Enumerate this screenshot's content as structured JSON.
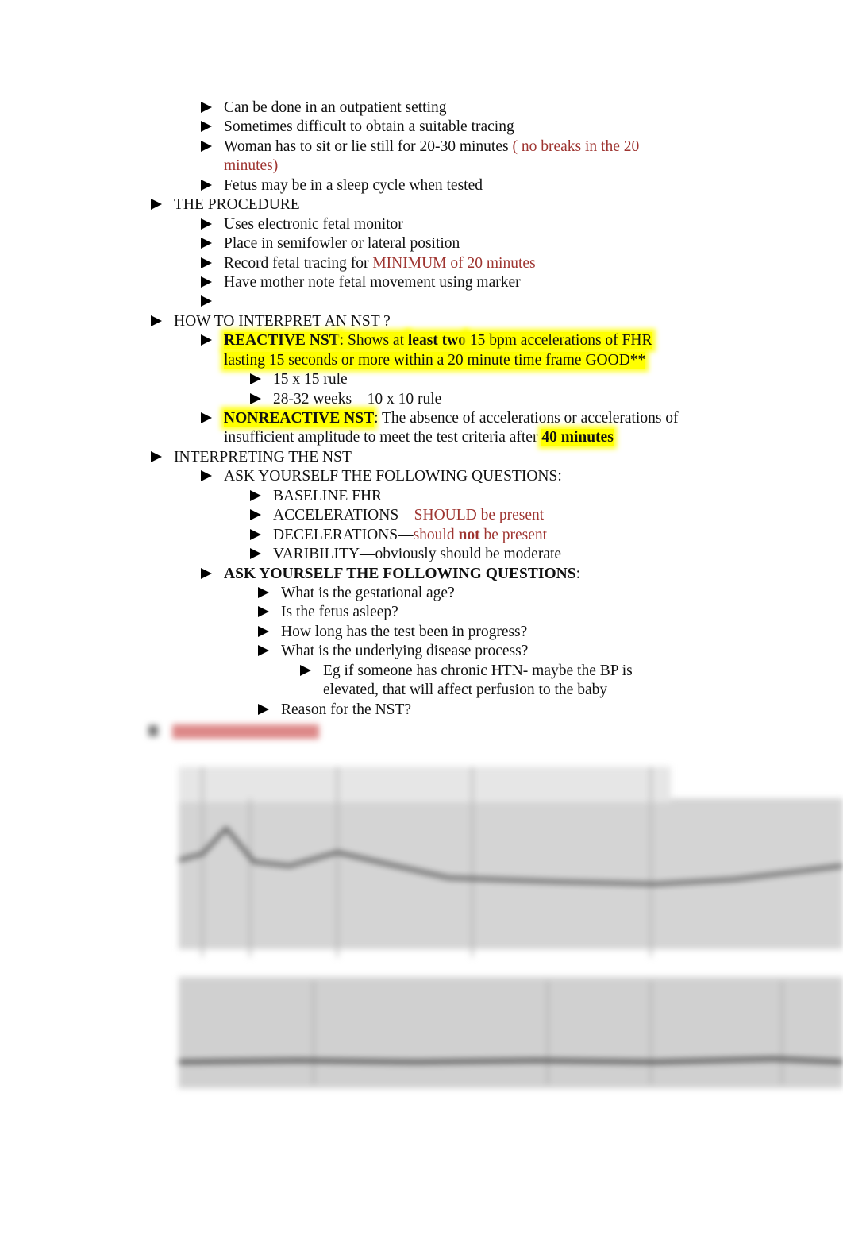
{
  "colors": {
    "accent_red": "#9e3430",
    "highlight": "#ffff00"
  },
  "bullet_icon": "black-right-triangle",
  "lines": [
    {
      "level": 2,
      "bullet": true,
      "segments": [
        {
          "t": "Can be done in an outpatient setting"
        }
      ]
    },
    {
      "level": 2,
      "bullet": true,
      "segments": [
        {
          "t": "Sometimes difficult to obtain a suitable tracing"
        }
      ]
    },
    {
      "level": 2,
      "bullet": true,
      "segments": [
        {
          "t": "Woman has to sit or lie still for 20-30 minutes "
        },
        {
          "t": "( no breaks in the 20",
          "s": "red"
        }
      ]
    },
    {
      "level": 2,
      "bullet": false,
      "segments": [
        {
          "t": "minutes)",
          "s": "red"
        }
      ]
    },
    {
      "level": 2,
      "bullet": true,
      "segments": [
        {
          "t": "Fetus may be in a sleep cycle when tested"
        }
      ]
    },
    {
      "level": 1,
      "bullet": true,
      "segments": [
        {
          "t": "THE PROCEDURE"
        }
      ]
    },
    {
      "level": 2,
      "bullet": true,
      "segments": [
        {
          "t": "Uses electronic fetal monitor"
        }
      ]
    },
    {
      "level": 2,
      "bullet": true,
      "segments": [
        {
          "t": "Place in semifowler or lateral position"
        }
      ]
    },
    {
      "level": 2,
      "bullet": true,
      "segments": [
        {
          "t": "Record fetal tracing for "
        },
        {
          "t": "MINIMUM of 20 minutes",
          "s": "red"
        }
      ]
    },
    {
      "level": 2,
      "bullet": true,
      "segments": [
        {
          "t": "Have mother note fetal movement using marker"
        }
      ]
    },
    {
      "level": 2,
      "bullet": true,
      "segments": []
    },
    {
      "level": 1,
      "bullet": true,
      "segments": [
        {
          "t": "HOW TO INTERPRET AN NST ?"
        }
      ]
    },
    {
      "level": 2,
      "bullet": true,
      "segments": [
        {
          "t": "REACTIVE NST",
          "s": "b hl"
        },
        {
          "t": ":  Shows at ",
          "s": "hl"
        },
        {
          "t": "least two",
          "s": "b hl"
        },
        {
          "t": " 15 bpm accelerations of FHR",
          "s": "hl"
        }
      ]
    },
    {
      "level": 2,
      "bullet": false,
      "segments": [
        {
          "t": "lasting 15 seconds or more within a 20 minute time frame GOOD**",
          "s": "hl"
        }
      ]
    },
    {
      "level": 3,
      "bullet": true,
      "segments": [
        {
          "t": "15 x 15 rule"
        }
      ]
    },
    {
      "level": 3,
      "bullet": true,
      "segments": [
        {
          "t": "28-32 weeks – 10 x 10 rule"
        }
      ]
    },
    {
      "level": 2,
      "bullet": true,
      "segments": [
        {
          "t": "NONREACTIVE NST",
          "s": "b hl"
        },
        {
          "t": ":  The absence of accelerations or accelerations of"
        }
      ]
    },
    {
      "level": 2,
      "bullet": false,
      "segments": [
        {
          "t": "insufficient amplitude to meet the test criteria after "
        },
        {
          "t": "40 minutes",
          "s": "b hl"
        }
      ]
    },
    {
      "level": 1,
      "bullet": true,
      "segments": [
        {
          "t": "INTERPRETING THE NST"
        }
      ]
    },
    {
      "level": 2,
      "bullet": true,
      "segments": [
        {
          "t": "ASK YOURSELF THE FOLLOWING QUESTIONS:"
        }
      ]
    },
    {
      "level": 3,
      "bullet": true,
      "segments": [
        {
          "t": "BASELINE FHR"
        }
      ]
    },
    {
      "level": 3,
      "bullet": true,
      "segments": [
        {
          "t": "ACCELERATIONS—"
        },
        {
          "t": "SHOULD be present",
          "s": "red"
        }
      ]
    },
    {
      "level": 3,
      "bullet": true,
      "segments": [
        {
          "t": "DECELERATIONS—"
        },
        {
          "t": "should ",
          "s": "red"
        },
        {
          "t": "not",
          "s": "red b"
        },
        {
          "t": " be present",
          "s": "red"
        }
      ]
    },
    {
      "level": 3,
      "bullet": true,
      "segments": [
        {
          "t": "VARIBILITY—obviously should be moderate"
        }
      ]
    },
    {
      "level": 2,
      "bullet": true,
      "segments": [
        {
          "t": "ASK YOURSELF THE FOLLOWING QUESTIONS",
          "s": "b"
        },
        {
          "t": ":"
        }
      ]
    },
    {
      "level": 3.5,
      "bullet": true,
      "segments": [
        {
          "t": "What is the gestational age?"
        }
      ]
    },
    {
      "level": 3.5,
      "bullet": true,
      "segments": [
        {
          "t": "Is the fetus asleep?"
        }
      ]
    },
    {
      "level": 3.5,
      "bullet": true,
      "segments": [
        {
          "t": "How long has the test been in progress?"
        }
      ]
    },
    {
      "level": 3.5,
      "bullet": true,
      "segments": [
        {
          "t": "What is the underlying disease process?"
        }
      ]
    },
    {
      "level": 4,
      "bullet": true,
      "segments": [
        {
          "t": "Eg if someone has chronic HTN- maybe the BP is"
        }
      ]
    },
    {
      "level": 4,
      "bullet": false,
      "segments": [
        {
          "t": "elevated, that will affect perfusion to the baby"
        }
      ]
    },
    {
      "level": 3.5,
      "bullet": true,
      "segments": [
        {
          "t": "Reason for the NST?"
        }
      ]
    }
  ]
}
